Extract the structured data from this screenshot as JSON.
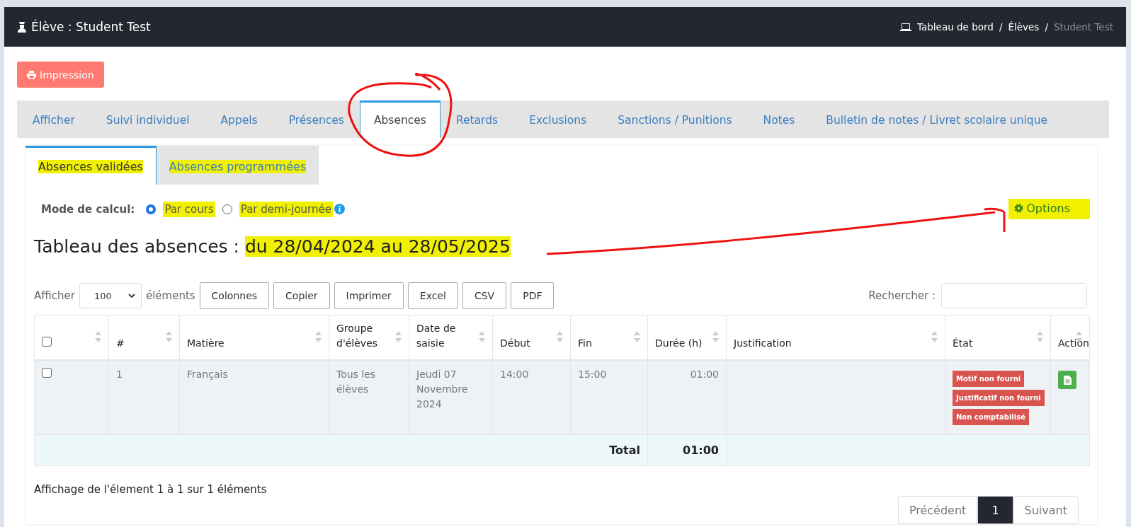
{
  "header": {
    "title": "Élève : Student Test",
    "breadcrumb": [
      {
        "label": "Tableau de bord",
        "kind": "link"
      },
      {
        "label": "Élèves",
        "kind": "link"
      },
      {
        "label": "Student Test",
        "kind": "current"
      }
    ],
    "separator": "/"
  },
  "print_button": "Impression",
  "tabs": [
    {
      "label": "Afficher",
      "selected": false
    },
    {
      "label": "Suivi individuel",
      "selected": false
    },
    {
      "label": "Appels",
      "selected": false
    },
    {
      "label": "Présences",
      "selected": false
    },
    {
      "label": "Absences",
      "selected": true
    },
    {
      "label": "Retards",
      "selected": false
    },
    {
      "label": "Exclusions",
      "selected": false
    },
    {
      "label": "Sanctions / Punitions",
      "selected": false
    },
    {
      "label": "Notes",
      "selected": false
    },
    {
      "label": "Bulletin de notes / Livret scolaire unique",
      "selected": false
    }
  ],
  "subtabs": [
    {
      "label": "Absences validées",
      "selected": true,
      "highlighted": true
    },
    {
      "label": "Absences programmées",
      "selected": false,
      "highlighted": true
    }
  ],
  "mode": {
    "label": "Mode de calcul:",
    "options": [
      {
        "label": "Par cours",
        "selected": true,
        "highlighted": true
      },
      {
        "label": "Par demi-journée",
        "selected": false,
        "highlighted": true
      }
    ]
  },
  "options_link": {
    "label": "Options",
    "highlighted": true
  },
  "title": {
    "prefix": "Tableau des absences : ",
    "range": "du 28/04/2024 au 28/05/2025",
    "highlighted": true
  },
  "toolbar": {
    "show_label": "Afficher",
    "page_size": "100",
    "show_suffix": "éléments",
    "buttons": [
      "Colonnes",
      "Copier",
      "Imprimer",
      "Excel",
      "CSV",
      "PDF"
    ],
    "search_label": "Rechercher :"
  },
  "table": {
    "columns": [
      {
        "kind": "checkbox",
        "checked": false
      },
      {
        "label": "#",
        "kind": "text"
      },
      {
        "label": "Matière",
        "kind": "text"
      },
      {
        "label": "Groupe d'élèves",
        "kind": "text"
      },
      {
        "label": "Date de saisie",
        "kind": "text"
      },
      {
        "label": "Début",
        "kind": "text"
      },
      {
        "label": "Fin",
        "kind": "text"
      },
      {
        "label": "Durée (h)",
        "kind": "text"
      },
      {
        "label": "Justification",
        "kind": "text"
      },
      {
        "label": "État",
        "kind": "text"
      },
      {
        "label": "Action",
        "kind": "text"
      }
    ],
    "rows": [
      {
        "checked": false,
        "number": "1",
        "subject": "Français",
        "group": "Tous les élèves",
        "date": "Jeudi 07 Novembre 2024",
        "start": "14:00",
        "end": "15:00",
        "duration": "01:00",
        "states": [
          "Motif non fourni",
          "Justificatif non fourni",
          "Non comptabilisé"
        ]
      }
    ],
    "total_label": "Total",
    "total_value": "01:00"
  },
  "info": "Affichage de l'élement 1 à 1 sur 1 éléments",
  "pagination": [
    {
      "label": "Précédent",
      "kind": "prev",
      "selected": false
    },
    {
      "label": "1",
      "kind": "page",
      "selected": true
    },
    {
      "label": "Suivant",
      "kind": "next",
      "selected": false
    }
  ],
  "annotations": {
    "circle": true,
    "arrow": true
  }
}
